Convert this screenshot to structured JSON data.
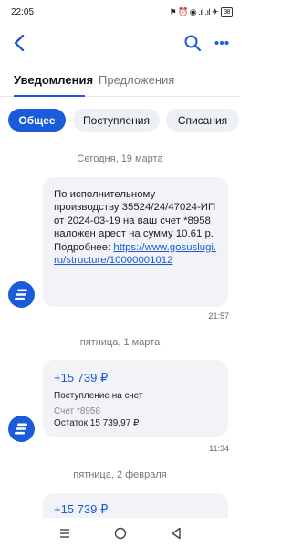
{
  "status_bar": {
    "time": "22:05",
    "icons_text": "⚑ ⏰ ◉ .ıl .ıl ✈",
    "battery": "38"
  },
  "header": {
    "back_icon": "back-arrow-icon",
    "search_icon": "search-icon",
    "more_icon": "more-dots-icon"
  },
  "tabs": [
    {
      "label": "Уведомления",
      "active": true
    },
    {
      "label": "Предложения",
      "active": false
    }
  ],
  "chips": [
    {
      "label": "Общее",
      "active": true
    },
    {
      "label": "Поступления",
      "active": false
    },
    {
      "label": "Списания",
      "active": false
    }
  ],
  "feed": [
    {
      "date": "Сегодня, 19 марта",
      "message": {
        "text": "По исполнительному производству 35524/24/47024-ИП от 2024-03-19 на ваш счет *8958 наложен арест на сумму 10.61 р. Подробнее: ",
        "link": "https://www.gosuslugi.ru/structure/10000001012",
        "time": "21:57"
      }
    },
    {
      "date": "пятница, 1 марта",
      "message": {
        "amount": "+15 739 ₽",
        "title": "Поступление на счет",
        "account": "Счет *8958",
        "balance": "Остаток 15 739,97 ₽",
        "time": "11:34"
      }
    },
    {
      "date": "пятница, 2 февраля",
      "message": {
        "amount": "+15 739 ₽"
      }
    }
  ],
  "colors": {
    "accent": "#1a5bd9",
    "bubble_bg": "#f1f3f6",
    "chip_bg": "#edf0f4"
  }
}
